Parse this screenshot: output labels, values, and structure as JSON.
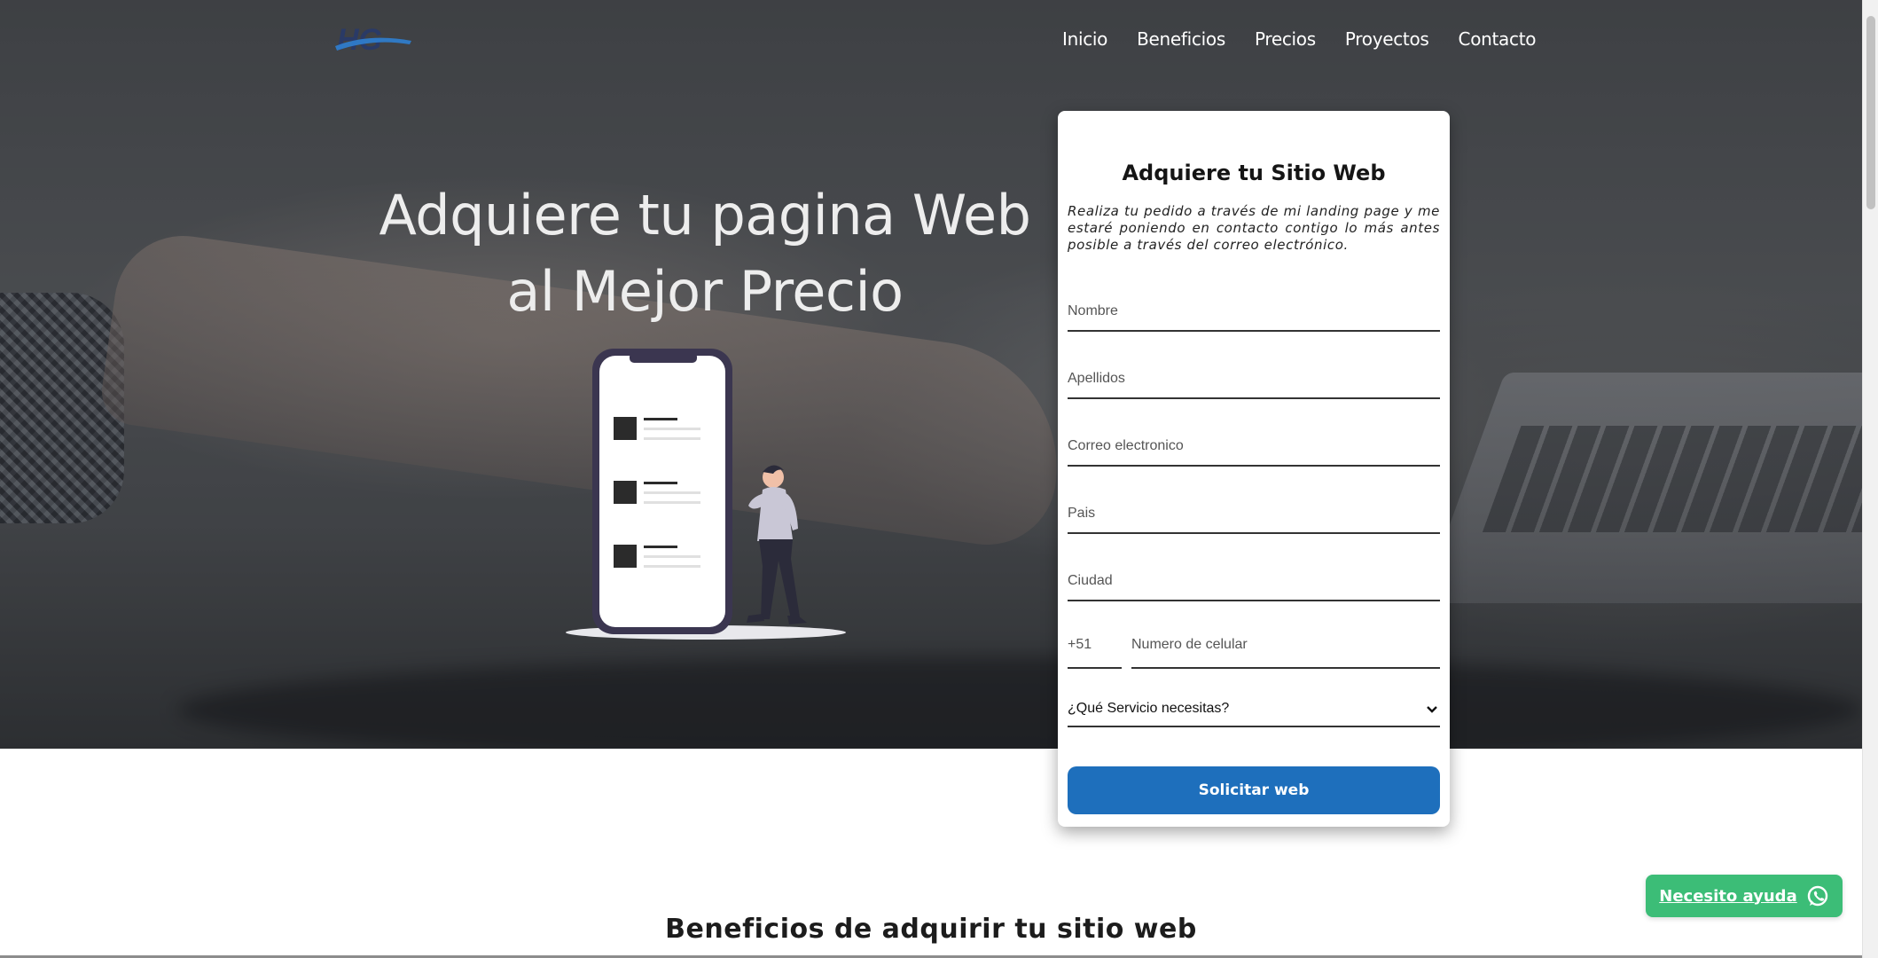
{
  "nav": {
    "logo_text": "HG",
    "links": [
      "Inicio",
      "Beneficios",
      "Precios",
      "Proyectos",
      "Contacto"
    ]
  },
  "hero": {
    "title": "Adquiere tu pagina Web al Mejor Precio"
  },
  "form": {
    "title": "Adquiere tu Sitio Web",
    "description": "Realiza tu pedido a través de mi landing page y me estaré poniendo en contacto contigo lo más antes posible a través del correo electrónico.",
    "fields": {
      "nombre": "Nombre",
      "apellidos": "Apellidos",
      "correo": "Correo electronico",
      "pais": "Pais",
      "ciudad": "Ciudad",
      "phone_code": "+51",
      "phone_number": "Numero de celular"
    },
    "service_select": "¿Qué Servicio necesitas?",
    "submit_label": "Solicitar web"
  },
  "benefits": {
    "title": "Beneficios de adquirir tu sitio web"
  },
  "help_button": {
    "label": "Necesito ayuda",
    "icon": "whatsapp-icon"
  },
  "colors": {
    "accent_blue": "#1e6fbc",
    "whatsapp_green": "#3cbd77"
  }
}
